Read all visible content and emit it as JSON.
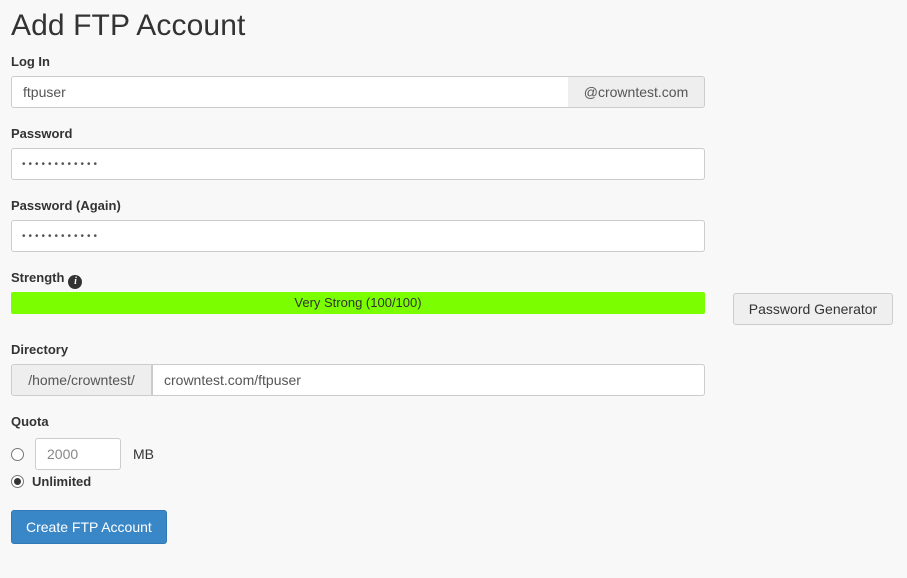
{
  "page": {
    "title": "Add FTP Account"
  },
  "login": {
    "label": "Log In",
    "value": "ftpuser",
    "placeholder": "",
    "domain_suffix": "@crowntest.com"
  },
  "password": {
    "label": "Password",
    "masked_value": "••••••••••••",
    "placeholder": ""
  },
  "password_again": {
    "label": "Password (Again)",
    "masked_value": "••••••••••••",
    "placeholder": ""
  },
  "strength": {
    "label": "Strength",
    "info_icon": "info-icon",
    "info_glyph": "i",
    "text": "Very Strong (100/100)",
    "score": 100,
    "max_score": 100,
    "percent": 100,
    "fill_color": "#7bff00",
    "track_color": "#ededed"
  },
  "password_generator": {
    "label": "Password Generator"
  },
  "directory": {
    "label": "Directory",
    "prefix": "/home/crowntest/",
    "value": "crowntest.com/ftpuser",
    "placeholder": ""
  },
  "quota": {
    "label": "Quota",
    "limited_selected": false,
    "amount_value": "2000",
    "amount_placeholder": "2000",
    "unit_label": "MB",
    "unlimited_selected": true,
    "unlimited_label": "Unlimited"
  },
  "submit": {
    "label": "Create FTP Account",
    "color": "#3a87c8"
  }
}
